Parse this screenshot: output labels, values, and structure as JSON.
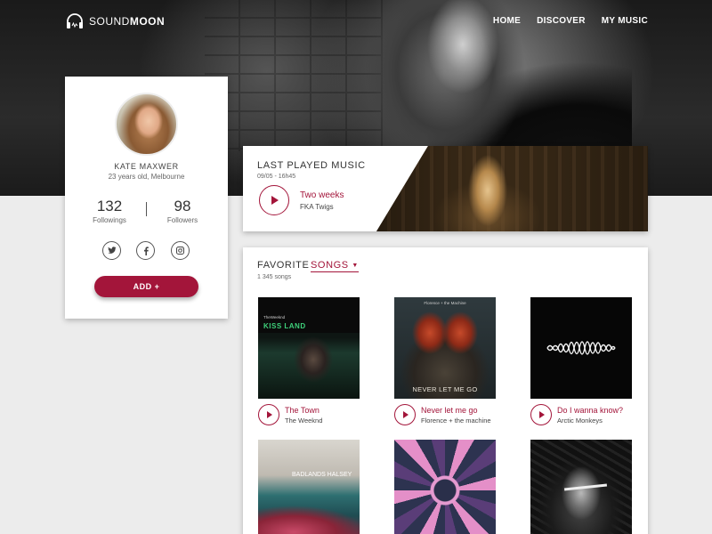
{
  "brand": {
    "logo_light": "SOUND",
    "logo_bold": "MOON",
    "icon": "headphones-icon"
  },
  "nav": {
    "items": [
      "HOME",
      "DISCOVER",
      "MY MUSIC"
    ]
  },
  "profile": {
    "name": "KATE MAXWER",
    "subtitle": "23 years old, Melbourne",
    "followings_value": "132",
    "followings_label": "Followings",
    "followers_value": "98",
    "followers_label": "Followers",
    "social": {
      "twitter": "twitter-icon",
      "facebook": "facebook-icon",
      "instagram": "instagram-icon"
    },
    "add_label": "ADD +"
  },
  "last_played": {
    "title": "LAST PLAYED MUSIC",
    "date": "09/05 - 16h45",
    "song": "Two weeks",
    "artist": "FKA Twigs"
  },
  "favorites": {
    "title_prefix": "FAVORITE ",
    "dropdown_label": "SONGS",
    "count": "1 345 songs",
    "albums": [
      {
        "title": "The Town",
        "artist": "The Weeknd",
        "cover_text": "KISS LAND",
        "cover_pre": "TheWeeknd"
      },
      {
        "title": "Never let me go",
        "artist": "Florence + the machine",
        "cover_text": "NEVER LET ME GO",
        "cover_pre": "Florence + the Machine"
      },
      {
        "title": "Do I wanna know?",
        "artist": "Arctic Monkeys"
      },
      {
        "title": "",
        "artist": "",
        "cover_text": "BADLANDS HALSEY"
      },
      {
        "title": "",
        "artist": ""
      },
      {
        "title": "",
        "artist": ""
      }
    ]
  },
  "colors": {
    "accent": "#a3153a",
    "page_bg": "#ececec",
    "hero_dark": "#1a1a1a"
  }
}
